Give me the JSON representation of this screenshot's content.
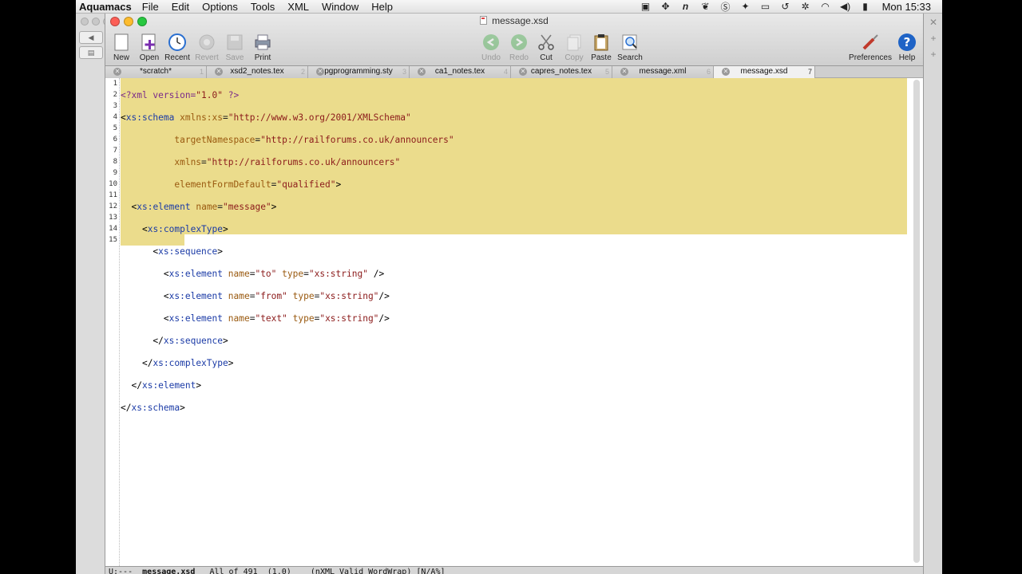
{
  "menubar": {
    "app_name": "Aquamacs",
    "items": [
      "File",
      "Edit",
      "Options",
      "Tools",
      "XML",
      "Window",
      "Help"
    ],
    "clock": "Mon 15:33"
  },
  "window": {
    "title": "message.xsd"
  },
  "toolbar": {
    "new": "New",
    "open": "Open",
    "recent": "Recent",
    "revert": "Revert",
    "save": "Save",
    "print": "Print",
    "undo": "Undo",
    "redo": "Redo",
    "cut": "Cut",
    "copy": "Copy",
    "paste": "Paste",
    "search": "Search",
    "preferences": "Preferences",
    "help": "Help"
  },
  "tabs": [
    {
      "label": "*scratch*",
      "num": "1"
    },
    {
      "label": "xsd2_notes.tex",
      "num": "2"
    },
    {
      "label": "pgprogramming.sty",
      "num": "3"
    },
    {
      "label": "ca1_notes.tex",
      "num": "4"
    },
    {
      "label": "capres_notes.tex",
      "num": "5"
    },
    {
      "label": "message.xml",
      "num": "6"
    },
    {
      "label": "message.xsd",
      "num": "7"
    }
  ],
  "line_numbers": [
    "1",
    "2",
    "3",
    "4",
    "5",
    "6",
    "7",
    "8",
    "9",
    "10",
    "11",
    "12",
    "13",
    "14",
    "15"
  ],
  "modeline": {
    "status": "U:---",
    "buffer": "message.xsd",
    "position": "All of 491  (1,0)",
    "modes": "(nXML Valid WordWrap) [N/A%]"
  },
  "colors": {
    "selection": "#ebdc8c",
    "tag": "#1a3aa6",
    "attribute": "#9a5a10",
    "string": "#8b1a1a"
  }
}
